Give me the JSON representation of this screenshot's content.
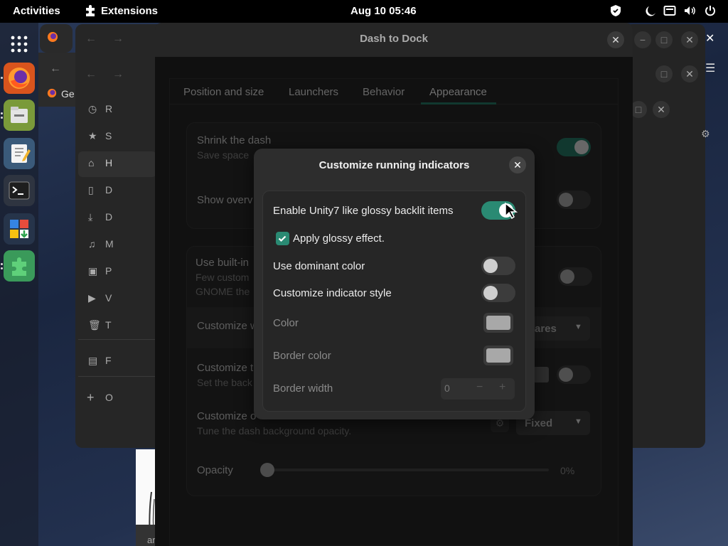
{
  "topbar": {
    "activities": "Activities",
    "app_name": "Extensions",
    "clock": "Aug 10  05:46"
  },
  "dock": {
    "items": [
      "firefox",
      "files",
      "text-editor",
      "terminal",
      "software-center",
      "extensions"
    ]
  },
  "bg_window": {
    "tab_label": "Ge",
    "sidebar": [
      "R",
      "S",
      "H",
      "D",
      "D",
      "M",
      "P",
      "V",
      "T",
      "F",
      "O"
    ],
    "footer_text": "ar"
  },
  "prefs": {
    "title": "Dash to Dock",
    "tabs": [
      "Position and size",
      "Launchers",
      "Behavior",
      "Appearance"
    ],
    "active_tab": "Appearance",
    "shrink": {
      "title": "Shrink the dash",
      "subtitle": "Save space"
    },
    "show_overview": {
      "title": "Show overv"
    },
    "builtin": {
      "title": "Use built-in",
      "subtitle1": "Few custom",
      "subtitle2": "GNOME the"
    },
    "customize_w": {
      "title": "Customize w",
      "dropdown": "ares"
    },
    "customize_t": {
      "title": "Customize t",
      "subtitle": "Set the back"
    },
    "opacity_mode": {
      "title": "Customize o",
      "subtitle": "Tune the dash background opacity.",
      "dropdown": "Fixed"
    },
    "opacity": {
      "label": "Opacity",
      "value": "0%",
      "fraction": 0
    }
  },
  "modal": {
    "title": "Customize running indicators",
    "glossy": {
      "label": "Enable Unity7 like glossy backlit items",
      "on": true
    },
    "apply_glossy": {
      "label": "Apply glossy effect.",
      "checked": true
    },
    "dominant": {
      "label": "Use dominant color",
      "on": false
    },
    "indicator_style": {
      "label": "Customize indicator style",
      "on": false
    },
    "color": {
      "label": "Color",
      "value": "#a8a8a8"
    },
    "border_color": {
      "label": "Border color",
      "value": "#a8a8a8"
    },
    "border_width": {
      "label": "Border width",
      "value": "0",
      "minus": "−",
      "plus": "+"
    }
  },
  "colors": {
    "accent": "#2a8a73",
    "topbar": "#000000",
    "dialog": "#2d2d2d"
  }
}
